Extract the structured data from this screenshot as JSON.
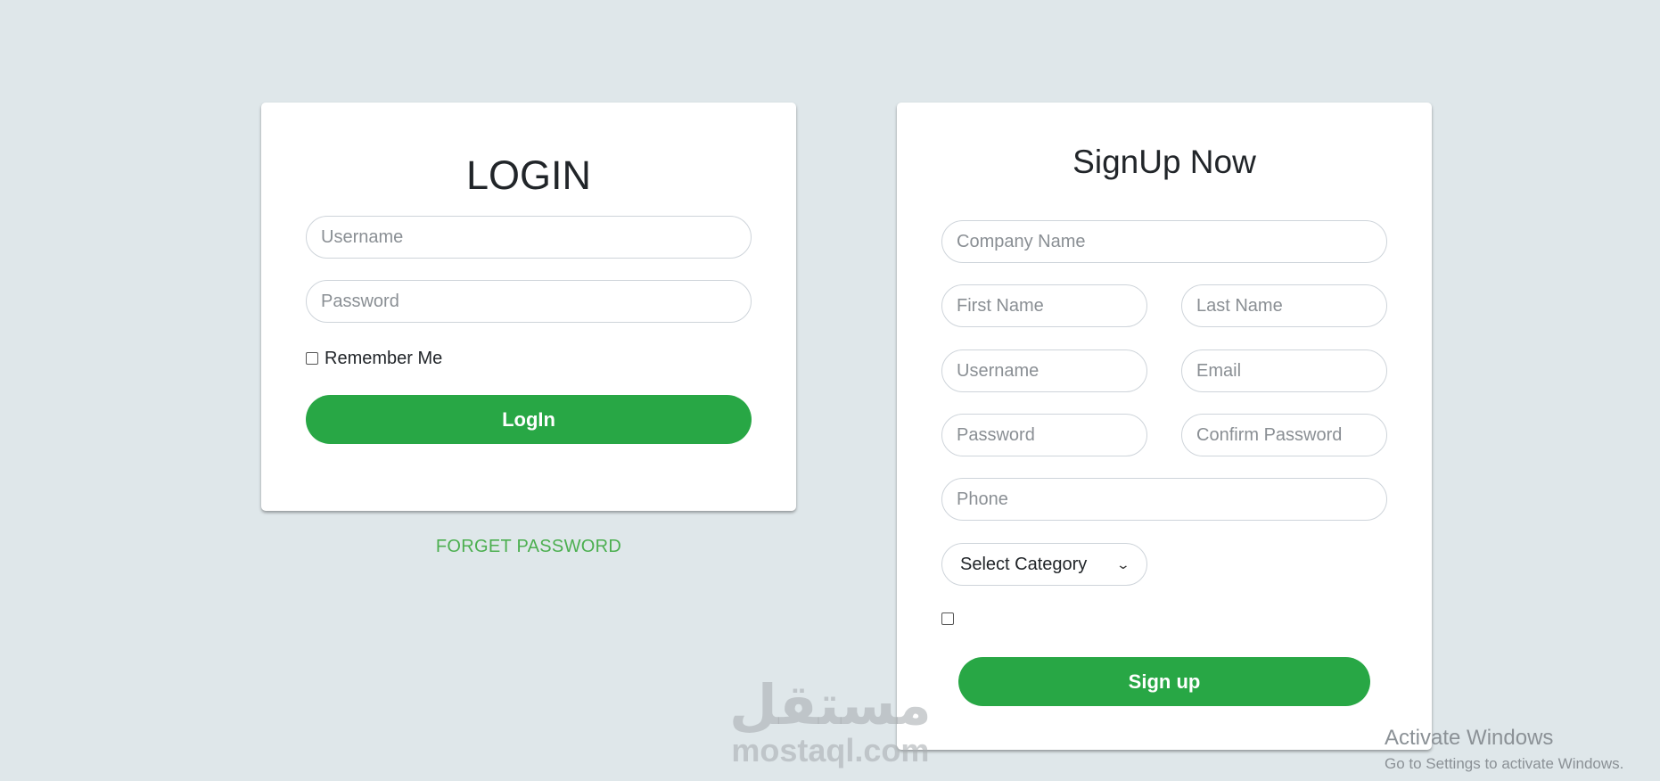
{
  "login": {
    "title": "LOGIN",
    "username_placeholder": "Username",
    "password_placeholder": "Password",
    "remember_label": "Remember Me",
    "button_label": "LogIn",
    "forget_link": "FORGET PASSWORD"
  },
  "signup": {
    "title": "SignUp Now",
    "company_placeholder": "Company Name",
    "first_name_placeholder": "First Name",
    "last_name_placeholder": "Last Name",
    "username_placeholder": "Username",
    "email_placeholder": "Email",
    "password_placeholder": "Password",
    "confirm_password_placeholder": "Confirm Password",
    "phone_placeholder": "Phone",
    "category_selected": "Select Category",
    "button_label": "Sign up"
  },
  "watermark": {
    "arabic": "مستقل",
    "latin": "mostaql.com"
  },
  "os_overlay": {
    "line1": "Activate Windows",
    "line2": "Go to Settings to activate Windows."
  },
  "colors": {
    "background": "#dfe7ea",
    "accent_green": "#28a745",
    "link_green": "#4caf50"
  },
  "icons": {
    "select_arrow": "chevron-down-icon"
  }
}
